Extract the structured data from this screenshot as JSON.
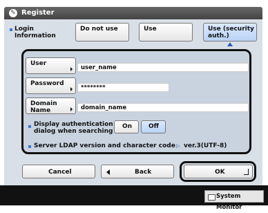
{
  "title": "Register",
  "login": {
    "label_line1": "Login",
    "label_line2": "Information",
    "options": [
      "Do not use",
      "Use",
      "Use (security",
      "auth.)"
    ]
  },
  "fields": {
    "user_label": "User",
    "user_value": "user_name",
    "password_label": "Password",
    "password_value": "********",
    "domain_label": "Domain Name",
    "domain_value": "domain_name"
  },
  "auth_dialog": {
    "label_line1": "Display authentication",
    "label_line2": "dialog when searching",
    "on": "On",
    "off": "Off"
  },
  "ldap": {
    "label": "Server LDAP version and character code",
    "value": "ver.3(UTF-8)"
  },
  "footer": {
    "cancel": "Cancel",
    "back": "Back",
    "ok": "OK"
  },
  "system_monitor": "System Monitor"
}
